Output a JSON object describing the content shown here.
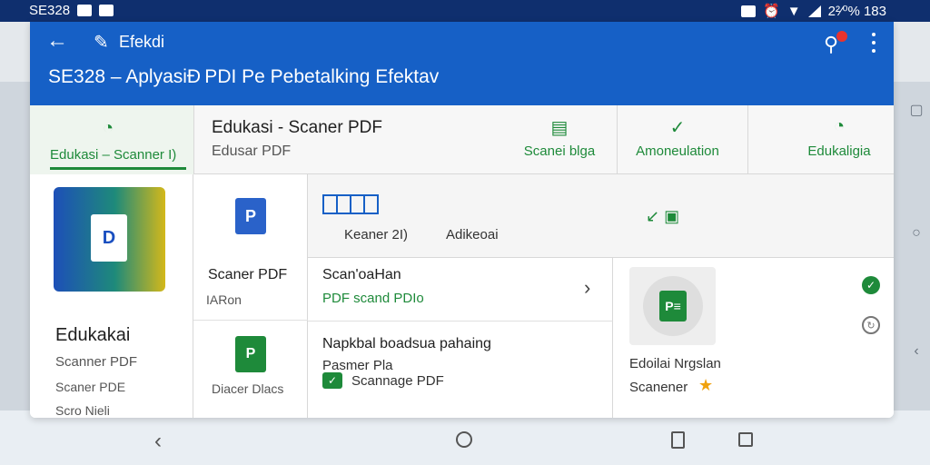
{
  "status_bar": {
    "left_text": "SE328",
    "right_text": "2²⁄⁰% 183"
  },
  "header": {
    "brand": "Efekdi",
    "page_title": "SE328 – AplyasiÐ PDI Pe Pebetalking Efektav",
    "icons": [
      "back-arrow-icon",
      "pen-icon",
      "search-icon",
      "more-vert-icon"
    ],
    "accent_color": "#1660c6",
    "notification_color": "#e8332f"
  },
  "tabs": {
    "active_label": "Edukasi – Scanner I)",
    "heading": "Edukasi - Scaner PDF",
    "subheading": "Edusar PDF",
    "items": [
      {
        "label": "Scanei blga",
        "icon": "document-icon"
      },
      {
        "label": "Amoneulation",
        "icon": "magnify-check-icon"
      },
      {
        "label": "Edukaligia",
        "icon": "gauge-icon"
      }
    ],
    "accent_color": "#1e8a3a"
  },
  "left_panel": {
    "title": "Edukakai",
    "lines": [
      "Scanner PDF",
      "Scaner PDE",
      "Scro Nieli"
    ]
  },
  "middle_column": {
    "item1_label": "Scaner PDF",
    "item1_sub": "IARon",
    "item2_label": "Diacer Dlacs"
  },
  "main_top": {
    "label1": "Keaner 2I)",
    "label2": "Adikeoai"
  },
  "list": [
    {
      "title": "Scan'oaHan",
      "subtitle": "PDF scand PDIo"
    },
    {
      "title": "Napkbal boadsua pahaing",
      "subtitle": "Pasmer Pla",
      "action_label": "Scannage PDF"
    }
  ],
  "right_card": {
    "title": "Edoilai Nrgslan",
    "subtitle": "Scanener"
  },
  "nav_bar": {
    "icons": [
      "back-triangle-icon",
      "home-circle-icon",
      "doc-icon",
      "recents-square-icon"
    ]
  }
}
